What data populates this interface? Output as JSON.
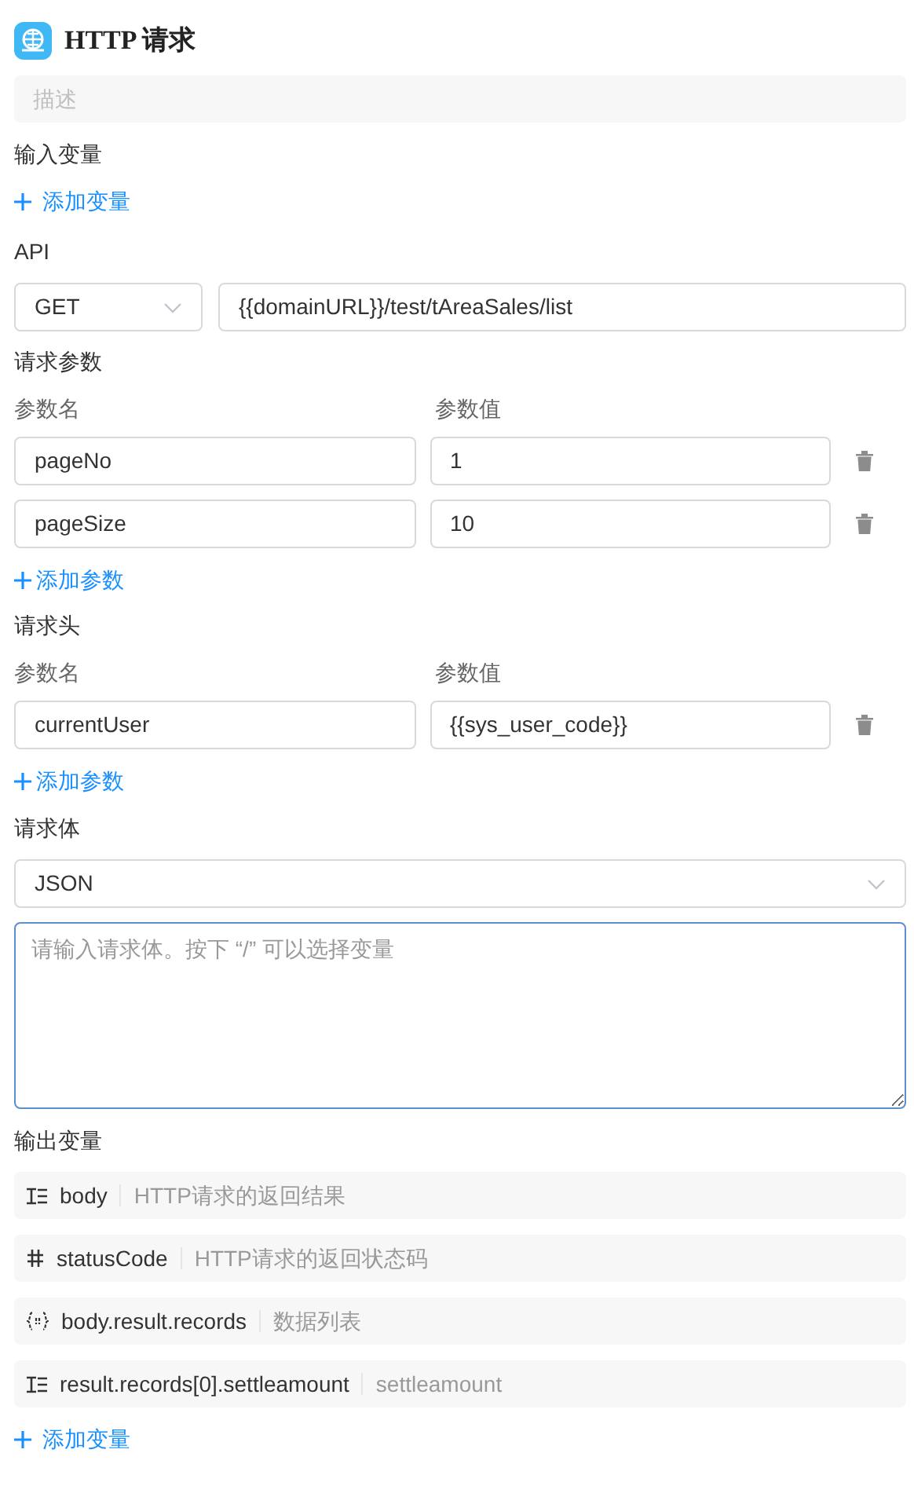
{
  "node": {
    "title": "HTTP 请求",
    "description_placeholder": "描述"
  },
  "input_variables": {
    "label": "输入变量",
    "add_label": "添加变量"
  },
  "api": {
    "label": "API",
    "method": "GET",
    "url": "{{domainURL}}/test/tAreaSales/list"
  },
  "params": {
    "label": "请求参数",
    "name_header": "参数名",
    "value_header": "参数值",
    "rows": [
      {
        "name": "pageNo",
        "value": "1"
      },
      {
        "name": "pageSize",
        "value": "10"
      }
    ],
    "add_label": "添加参数"
  },
  "headers": {
    "label": "请求头",
    "name_header": "参数名",
    "value_header": "参数值",
    "rows": [
      {
        "name": "currentUser",
        "value": "{{sys_user_code}}"
      }
    ],
    "add_label": "添加参数"
  },
  "body": {
    "label": "请求体",
    "format": "JSON",
    "placeholder": "请输入请求体。按下 “/” 可以选择变量",
    "focused": true
  },
  "output_variables": {
    "label": "输出变量",
    "items": [
      {
        "kind": "string",
        "name": "body",
        "description": "HTTP请求的返回结果"
      },
      {
        "kind": "number",
        "name": "statusCode",
        "description": "HTTP请求的返回状态码"
      },
      {
        "kind": "object",
        "name": "body.result.records",
        "description": "数据列表"
      },
      {
        "kind": "string",
        "name": "result.records[0].settleamount",
        "description": "settleamount"
      }
    ],
    "add_label": "添加变量"
  }
}
